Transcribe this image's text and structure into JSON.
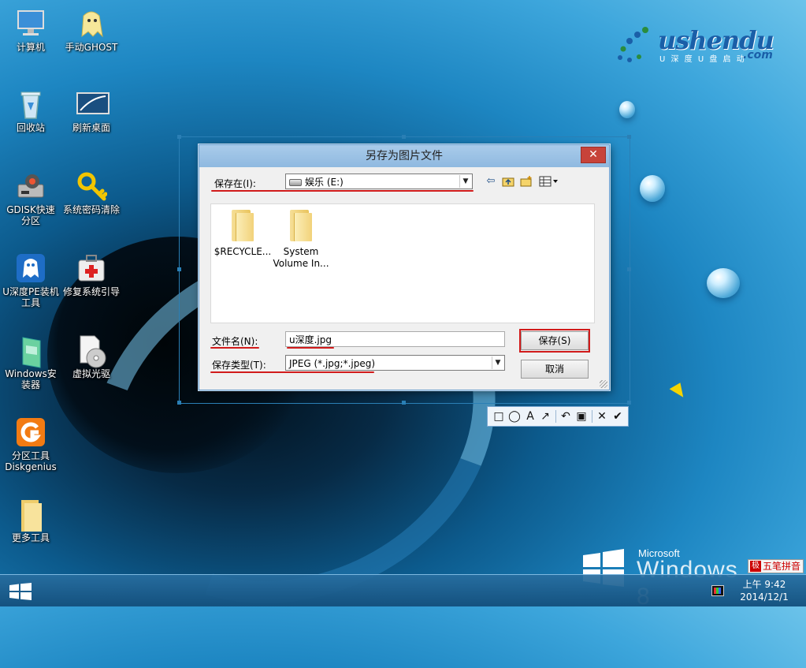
{
  "desktop": {
    "icons": [
      {
        "label": "计算机",
        "icon": "computer-icon"
      },
      {
        "label": "手动GHOST",
        "icon": "ghost-icon"
      },
      {
        "label": "回收站",
        "icon": "recycle-bin-icon"
      },
      {
        "label": "刷新桌面",
        "icon": "refresh-desktop-icon"
      },
      {
        "label": "GDISK快速分区",
        "icon": "gdisk-icon"
      },
      {
        "label": "系统密码清除",
        "icon": "key-icon"
      },
      {
        "label": "U深度PE装机工具",
        "icon": "pe-installer-icon"
      },
      {
        "label": "修复系统引导",
        "icon": "repair-boot-icon"
      },
      {
        "label": "Windows安装器",
        "icon": "windows-installer-icon"
      },
      {
        "label": "虚拟光驱",
        "icon": "virtual-drive-icon"
      },
      {
        "label": "分区工具Diskgenius",
        "icon": "diskgenius-icon"
      },
      {
        "label": "更多工具",
        "icon": "folder-icon"
      }
    ],
    "logo": {
      "main": "ushendu",
      "sub": "U 深 度 U 盘 启 动",
      "com": ".com"
    },
    "brand": {
      "company": "Microsoft",
      "product": "Windows 8"
    }
  },
  "dialog": {
    "title": "另存为图片文件",
    "close_label": "✕",
    "save_in_label": "保存在(I):",
    "save_in_value": "娱乐 (E:)",
    "files": [
      {
        "name_line1": "$RECYCLE...",
        "name_line2": ""
      },
      {
        "name_line1": "System",
        "name_line2": "Volume In..."
      }
    ],
    "filename_label": "文件名(N):",
    "filename_value": "u深度.jpg",
    "filetype_label": "保存类型(T):",
    "filetype_value": "JPEG (*.jpg;*.jpeg)",
    "save_button": "保存(S)",
    "cancel_button": "取消"
  },
  "capture_toolbar": {
    "tools": [
      "rectangle-icon",
      "ellipse-icon",
      "text-icon",
      "arrow-icon",
      "undo-icon",
      "save-icon",
      "cancel-icon",
      "confirm-icon"
    ],
    "glyphs": {
      "rect": "□",
      "ellipse": "◯",
      "text": "A",
      "arrow": "↗",
      "undo": "↶",
      "save": "▣",
      "cancel": "✕",
      "confirm": "✔"
    }
  },
  "taskbar": {
    "time": "上午 9:42",
    "date": "2014/12/1",
    "ime_badge": "极",
    "ime_label": "五笔拼音"
  },
  "colors": {
    "accent": "#2a7fb5",
    "highlight_red": "#d11b1b",
    "close_red": "#c7433a"
  }
}
